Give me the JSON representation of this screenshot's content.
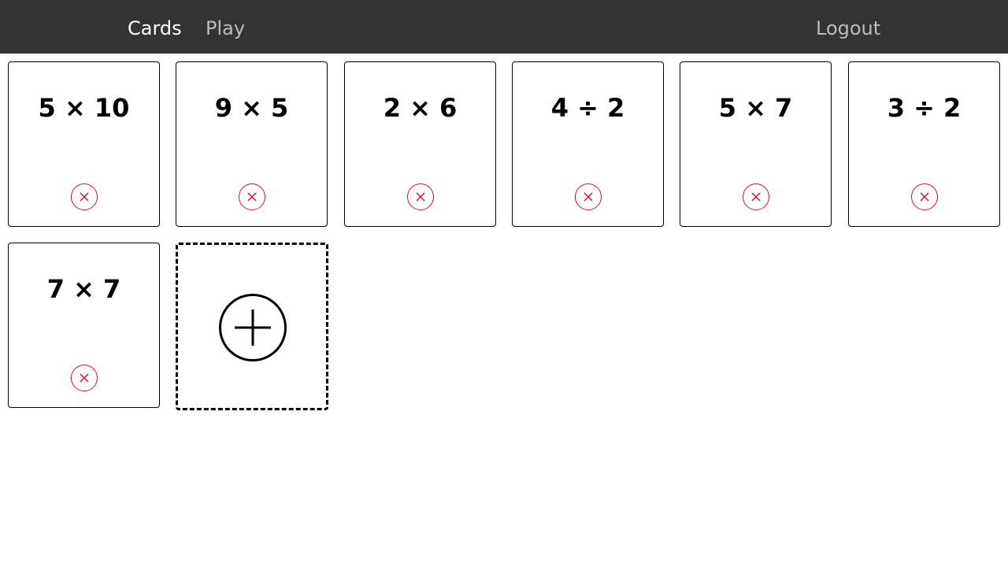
{
  "nav": {
    "cards_label": "Cards",
    "play_label": "Play",
    "logout_label": "Logout"
  },
  "cards": [
    {
      "expression": "5 × 10"
    },
    {
      "expression": "9 × 5"
    },
    {
      "expression": "2 × 6"
    },
    {
      "expression": "4 ÷ 2"
    },
    {
      "expression": "5 × 7"
    },
    {
      "expression": "3 ÷ 2"
    },
    {
      "expression": "7 × 7"
    }
  ],
  "icons": {
    "delete": "close-circle-icon",
    "add": "plus-circle-icon"
  },
  "colors": {
    "navbar_bg": "#333333",
    "nav_active": "#ffffff",
    "nav_inactive": "#bdbdbd",
    "delete_accent": "#c8102e",
    "card_border": "#000000"
  }
}
